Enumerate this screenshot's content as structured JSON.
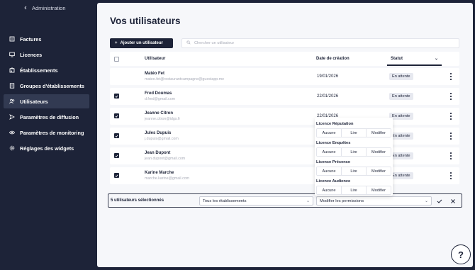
{
  "sidebar": {
    "back_label": "Administration",
    "items": [
      {
        "label": "Factures",
        "icon": "invoice-icon"
      },
      {
        "label": "Licences",
        "icon": "monitor-icon"
      },
      {
        "label": "Établissements",
        "icon": "building-icon"
      },
      {
        "label": "Groupes d'établissements",
        "icon": "document-icon"
      },
      {
        "label": "Utilisateurs",
        "icon": "users-icon",
        "active": true
      },
      {
        "label": "Paramètres de diffusion",
        "icon": "send-icon"
      },
      {
        "label": "Paramètres de monitoring",
        "icon": "eye-icon"
      },
      {
        "label": "Réglages des widgets",
        "icon": "gear-icon"
      }
    ]
  },
  "main": {
    "title": "Vos utilisateurs",
    "add_button": "Ajouter un utilisateur",
    "search_placeholder": "Chercher un utilisateur",
    "columns": {
      "user": "Utilisateur",
      "date": "Date de création",
      "status": "Statut"
    },
    "rows": [
      {
        "name": "Matéo Fet",
        "email": "mateo.fet@restaurantcampagne@guestapp.me",
        "date": "19/01/2026",
        "status": "En attente",
        "checked": false
      },
      {
        "name": "Fred Doumas",
        "email": "d.fred@gmail.com",
        "date": "22/01/2026",
        "status": "En attente",
        "checked": true
      },
      {
        "name": "Jeanne Citron",
        "email": "jeanne.citron@idgs.fr",
        "date": "22/01/2026",
        "status": "En attente",
        "checked": true
      },
      {
        "name": "Jules Dupuis",
        "email": "j.dupuis@gmail.com",
        "date": "",
        "status": "En attente",
        "checked": true
      },
      {
        "name": "Jean Dupont",
        "email": "jean.dupont@gmail.com",
        "date": "",
        "status": "En attente",
        "checked": true
      },
      {
        "name": "Karine Marche",
        "email": "marche.karine@gmail.com",
        "date": "",
        "status": "En attente",
        "checked": true
      }
    ]
  },
  "permissions_dropdown": {
    "options": [
      "Aucune",
      "Lire",
      "Modifier"
    ],
    "licences": [
      {
        "title": "Licence Réputation"
      },
      {
        "title": "Licence Enquêtes"
      },
      {
        "title": "Licence Présence"
      },
      {
        "title": "Licence Audience"
      }
    ]
  },
  "bulk_bar": {
    "selected_label": "5 utilisateurs sélectionnés",
    "establishments_select": "Tous les établissements",
    "permissions_select": "Modifier les permissions"
  },
  "help_button": "?",
  "colors": {
    "navy": "#1d2338",
    "panel": "#f6f7fa",
    "badge": "#e7e9f0"
  }
}
